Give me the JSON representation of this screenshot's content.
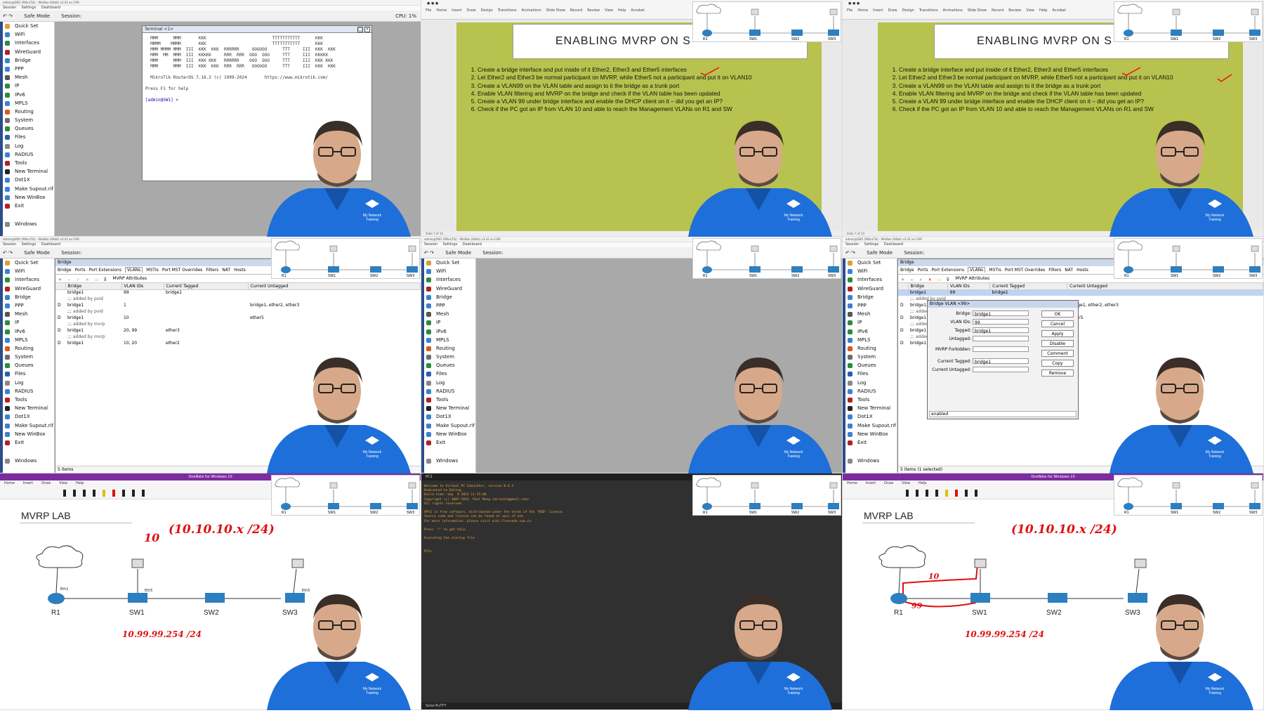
{
  "winbox": {
    "title": "admin@SW1 (MikroTik) - WinBox (64bit) v3.41 on CHR",
    "menu": [
      "Session",
      "Settings",
      "Dashboard"
    ],
    "safe_mode": "Safe Mode",
    "session_label": "Session:",
    "cpu": "CPU: 1%",
    "sidebar_items": [
      {
        "label": "Quick Set",
        "icon": "quickset-icon",
        "color": "#d9a12b"
      },
      {
        "label": "WiFi",
        "icon": "wifi-icon",
        "color": "#3c7fd1"
      },
      {
        "label": "Interfaces",
        "icon": "interfaces-icon",
        "color": "#2c8a3a"
      },
      {
        "label": "WireGuard",
        "icon": "wireguard-icon",
        "color": "#b02121"
      },
      {
        "label": "Bridge",
        "icon": "bridge-icon",
        "color": "#3c7fd1"
      },
      {
        "label": "PPP",
        "icon": "ppp-icon",
        "color": "#3c7fd1"
      },
      {
        "label": "Mesh",
        "icon": "mesh-icon",
        "color": "#555555"
      },
      {
        "label": "IP",
        "icon": "ip-icon",
        "color": "#2c8a3a"
      },
      {
        "label": "IPv6",
        "icon": "ipv6-icon",
        "color": "#2c8a3a"
      },
      {
        "label": "MPLS",
        "icon": "mpls-icon",
        "color": "#3c7fd1"
      },
      {
        "label": "Routing",
        "icon": "routing-icon",
        "color": "#d25b1f"
      },
      {
        "label": "System",
        "icon": "system-icon",
        "color": "#6b6b6b"
      },
      {
        "label": "Queues",
        "icon": "queues-icon",
        "color": "#2c8a3a"
      },
      {
        "label": "Files",
        "icon": "files-icon",
        "color": "#2a5db0"
      },
      {
        "label": "Log",
        "icon": "log-icon",
        "color": "#888888"
      },
      {
        "label": "RADIUS",
        "icon": "radius-icon",
        "color": "#3c7fd1"
      },
      {
        "label": "Tools",
        "icon": "tools-icon",
        "color": "#b02121"
      },
      {
        "label": "New Terminal",
        "icon": "terminal-icon",
        "color": "#222222"
      },
      {
        "label": "Dot1X",
        "icon": "dot1x-icon",
        "color": "#3c7fd1"
      },
      {
        "label": "Make Supout.rif",
        "icon": "supout-icon",
        "color": "#3c7fd1"
      },
      {
        "label": "New WinBox",
        "icon": "winbox-icon",
        "color": "#3c7fd1"
      },
      {
        "label": "Exit",
        "icon": "exit-icon",
        "color": "#b02121"
      },
      {
        "label": "Windows",
        "icon": "windows-icon",
        "color": "#888888"
      }
    ]
  },
  "terminal": {
    "title": "Terminal <1>",
    "banner": "  MMM      MMM       KKK                          TTTTTTTTTTT      KKK\n  MMMM    MMMM       KKK                          TTTTTTTTTTT      KKK\n  MMM MMMM MMM  III  KKK  KKK  RRRRRR     OOOOOO      TTT     III  KKK  KKK\n  MMM  MM  MMM  III  KKKKK     RRR  RRR  OOO  OOO     TTT     III  KKKKK\n  MMM      MMM  III  KKK KKK   RRRRRR    OOO  OOO     TTT     III  KKK KKK\n  MMM      MMM  III  KKK  KKK  RRR  RRR   OOOOOO      TTT     III  KKK  KKK",
    "version": "  MikroTik RouterOS 7.16.2 (c) 1999-2024       https://www.mikrotik.com/",
    "help": "Press F1 for help",
    "prompt": "[admin@SW1] > "
  },
  "slide": {
    "title": "ENABLING MVRP ON S",
    "steps": [
      "Create a bridge interface and put inside of it Ether2, Ether3 and Ether5 interfaces",
      "Let Ether2 and Ether3 be normal participant on MVRP, while Ether5 not a participant and put it on VLAN10",
      "Create a VLAN99 on the VLAN table and assign to it the bridge as a trunk port",
      "Enable VLAN filtering and MVRP on the bridge and check if the VLAN table has been updated",
      "Create a VLAN 99 under bridge interface and enable the DHCP client on it – did you get an IP?",
      "Check if the PC got an IP from VLAN 10 and able to reach the Management VLANs on R1 and SW"
    ],
    "ribbon_tabs": [
      "File",
      "Home",
      "Insert",
      "Draw",
      "Design",
      "Transitions",
      "Animations",
      "Slide Show",
      "Record",
      "Review",
      "View",
      "Help",
      "Acrobat"
    ],
    "status": "Slide 7 of 14"
  },
  "bridge_window": {
    "title": "Bridge",
    "tabs": [
      "Bridge",
      "Ports",
      "Port Extensions",
      "VLANs",
      "MSTIs",
      "Port MST Overrides",
      "Filters",
      "NAT",
      "Hosts"
    ],
    "active_tab": "VLANs",
    "mvrp_btn": "MVRP Attributes",
    "columns": [
      "Bridge",
      "VLAN IDs",
      "Current Tagged",
      "Current Untagged"
    ],
    "rows": [
      {
        "flag": "",
        "bridge": "bridge1",
        "vlan": "99",
        "tagged": "bridge1",
        "untagged": "",
        "comment": ""
      },
      {
        "flag": "",
        "bridge": ";;; added by pvid",
        "vlan": "",
        "tagged": "",
        "untagged": "",
        "comment": "yes"
      },
      {
        "flag": "D",
        "bridge": "bridge1",
        "vlan": "1",
        "tagged": "",
        "untagged": "bridge1, ether2, ether3",
        "comment": ""
      },
      {
        "flag": "",
        "bridge": ";;; added by pvid",
        "vlan": "",
        "tagged": "",
        "untagged": "",
        "comment": "yes"
      },
      {
        "flag": "D",
        "bridge": "bridge1",
        "vlan": "10",
        "tagged": "",
        "untagged": "ether5",
        "comment": ""
      },
      {
        "flag": "",
        "bridge": ";;; added by mvrp",
        "vlan": "",
        "tagged": "",
        "untagged": "",
        "comment": "yes"
      },
      {
        "flag": "D",
        "bridge": "bridge1",
        "vlan": "20, 99",
        "tagged": "ether3",
        "untagged": "",
        "comment": ""
      },
      {
        "flag": "",
        "bridge": ";;; added by mvrp",
        "vlan": "",
        "tagged": "",
        "untagged": "",
        "comment": "yes"
      },
      {
        "flag": "D",
        "bridge": "bridge1",
        "vlan": "10, 20",
        "tagged": "ether2",
        "untagged": "",
        "comment": ""
      }
    ],
    "status_left": "5 items",
    "status_right": "5 items (1 selected)"
  },
  "vlan_dialog": {
    "title": "Bridge VLAN <99>",
    "fields": [
      {
        "label": "Bridge:",
        "value": "bridge1"
      },
      {
        "label": "VLAN IDs:",
        "value": "99"
      },
      {
        "label": "Tagged:",
        "value": "bridge1"
      },
      {
        "label": "Untagged:",
        "value": ""
      },
      {
        "label": "MVRP Forbidden:",
        "value": ""
      },
      {
        "label": "Current Tagged:",
        "value": "bridge1"
      },
      {
        "label": "Current Untagged:",
        "value": ""
      }
    ],
    "buttons": [
      "OK",
      "Cancel",
      "Apply",
      "Disable",
      "Comment",
      "Copy",
      "Remove"
    ],
    "status": "enabled"
  },
  "onenote": {
    "titlebar": "OneNote for Windows 10",
    "menu": [
      "Home",
      "Insert",
      "Draw",
      "View",
      "Help"
    ],
    "page_title": "MVRP LAB",
    "devices": [
      "R1",
      "SW1",
      "SW2",
      "SW3"
    ],
    "ports": {
      "eth1": "Eth1",
      "eth2": "Eth2",
      "eth5": "Eth5"
    },
    "hand_vlan10": "10",
    "hand_subnet10": "(10.10.10.x /24)",
    "hand_mgmt": "10.99.99.254 /24",
    "hand_99": "99"
  },
  "vpcs": {
    "tab": "PC1",
    "text": "Welcome to Virtual PC Simulator, version 0.8.2\nDedicated to Daling.\nBuild time: Sep  9 2021 11:15:00\nCopyright (c) 2007-2015, Paul Meng (mirnshi@gmail.com)\nAll rights reserved.\n\nVPCS is free software, distributed under the terms of the \"BSD\" licence.\nSource code and license can be found at vpcs.sf.net.\nFor more information, please visit wiki.freecode.com.cn.\n\nPress '?' to get help.\n\nExecuting the startup file\n\n\nPC1> ",
    "status": "Solar-PuTTY"
  },
  "topology": {
    "labels": [
      "R1",
      "SW1",
      "SW2",
      "SW3"
    ]
  },
  "branding": {
    "shirt_text": "My Network Training"
  }
}
